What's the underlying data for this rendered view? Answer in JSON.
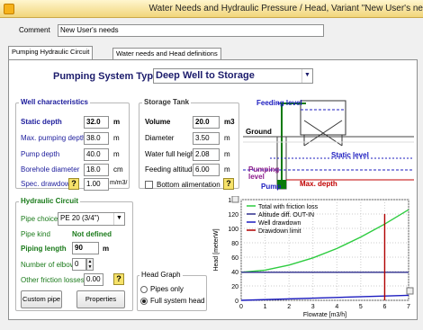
{
  "window": {
    "title": "Water Needs and Hydraulic Pressure / Head, Variant \"New User's ne"
  },
  "comment": {
    "label": "Comment",
    "value": "New User's needs"
  },
  "tabs": [
    {
      "label": "Pumping Hydraulic Circuit"
    },
    {
      "label": "Water needs and Head definitions"
    }
  ],
  "system_type": {
    "label": "Pumping System Type",
    "value": "Deep Well to Storage"
  },
  "well": {
    "title": "Well characteristics",
    "static_depth": {
      "label": "Static depth",
      "value": "32.0",
      "unit": "m"
    },
    "max_pumping_depth": {
      "label": "Max. pumping depth",
      "value": "38.0",
      "unit": "m"
    },
    "pump_depth": {
      "label": "Pump depth",
      "value": "40.0",
      "unit": "m"
    },
    "borehole_diameter": {
      "label": "Borehole diameter",
      "value": "18.0",
      "unit": "cm"
    },
    "spec_drawdown": {
      "label": "Spec. drawdown",
      "value": "1.00",
      "unit": "m/m3/h"
    }
  },
  "tank": {
    "title": "Storage Tank",
    "volume": {
      "label": "Volume",
      "value": "20.0",
      "unit": "m3"
    },
    "diameter": {
      "label": "Diameter",
      "value": "3.50",
      "unit": "m"
    },
    "water_full_height": {
      "label": "Water full height",
      "value": "2.08",
      "unit": "m"
    },
    "feeding_altitude": {
      "label": "Feeding altitude",
      "value": "6.00",
      "unit": "m"
    },
    "bottom_alimentation": {
      "label": "Bottom alimentation"
    }
  },
  "diagram": {
    "feeding_level": "Feeding level",
    "ground": "Ground",
    "static_level": "Static level",
    "pumping_level": "Pumping level",
    "pump": "Pump",
    "max_depth": "Max. depth",
    "colors": {
      "line": "#1c1cbf",
      "red": "#c00000",
      "pipe": "#0a7a0a"
    }
  },
  "circuit": {
    "title": "Hydraulic Circuit",
    "pipe_choice": {
      "label": "Pipe choice",
      "value": "PE 20 (3/4\")"
    },
    "pipe_kind": {
      "label": "Pipe kind",
      "value": "Not defined"
    },
    "piping_length": {
      "label": "Piping length",
      "value": "90",
      "unit": "m"
    },
    "elbows": {
      "label": "Number of elbows",
      "value": "0"
    },
    "friction": {
      "label": "Other friction losses",
      "value": "0.00"
    },
    "custom_pipe_btn": "Custom pipe",
    "properties_btn": "Properties"
  },
  "head_graph": {
    "title": "Head Graph",
    "pipes_only": "Pipes only",
    "full_system": "Full system head"
  },
  "chart_data": {
    "type": "line",
    "title": "",
    "xlabel": "Flowrate [m3/h]",
    "ylabel": "Head [meterW]",
    "xlim": [
      0,
      7
    ],
    "ylim": [
      0,
      140
    ],
    "xticks": [
      "0",
      "1",
      "2",
      "3",
      "4",
      "5",
      "6",
      "7"
    ],
    "yticks": [
      "0",
      "20",
      "40",
      "60",
      "80",
      "100",
      "120",
      "140"
    ],
    "legend_position": "top-left",
    "series": [
      {
        "name": "Total with friction loss",
        "color": "#2ecc40",
        "x": [
          0,
          1,
          2,
          3,
          4,
          5,
          6,
          7
        ],
        "y": [
          39,
          42,
          49,
          59,
          72,
          88,
          106,
          126
        ]
      },
      {
        "name": "Altitude diff. OUT-IN",
        "color": "#2d2d8c",
        "x": [
          0,
          7
        ],
        "y": [
          39,
          39
        ]
      },
      {
        "name": "Well drawdown",
        "color": "#1c1cbf",
        "x": [
          0,
          7
        ],
        "y": [
          0,
          7
        ]
      },
      {
        "name": "Drawdown limit",
        "color": "#b00000",
        "x": [
          6,
          6
        ],
        "y": [
          0,
          120
        ]
      }
    ]
  }
}
